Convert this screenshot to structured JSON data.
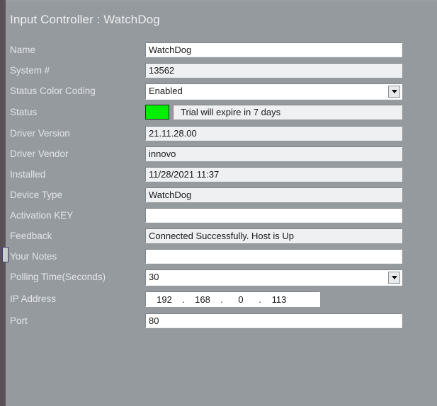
{
  "window": {
    "title": "Input Controller : WatchDog",
    "background_color": "#959a9e",
    "label_color": "#e3e5e8"
  },
  "form": {
    "rows": [
      {
        "label": "Name",
        "value": "WatchDog",
        "control": "text",
        "readonly": false
      },
      {
        "label": "System #",
        "value": "13562",
        "control": "text",
        "readonly": true
      },
      {
        "label": "Status Color Coding",
        "value": "Enabled",
        "control": "combobox",
        "readonly": false
      },
      {
        "label": "Status",
        "value": "Trial will expire in 7 days",
        "control": "status",
        "readonly": true
      },
      {
        "label": "Driver Version",
        "value": "21.11.28.00",
        "control": "text",
        "readonly": true
      },
      {
        "label": "Driver Vendor",
        "value": "innovo",
        "control": "text",
        "readonly": true
      },
      {
        "label": "Installed",
        "value": "11/28/2021 11:37",
        "control": "text",
        "readonly": true
      },
      {
        "label": "Device Type",
        "value": "WatchDog",
        "control": "text",
        "readonly": true
      },
      {
        "label": "Activation KEY",
        "value": "",
        "control": "text",
        "readonly": false
      },
      {
        "label": "Feedback",
        "value": "Connected Successfully.  Host is Up",
        "control": "text",
        "readonly": true
      },
      {
        "label": "Your Notes",
        "value": "",
        "control": "text",
        "readonly": false
      },
      {
        "label": "Polling Time(Seconds)",
        "value": "30",
        "control": "combobox",
        "readonly": false
      },
      {
        "label": "IP Address",
        "value": "192 . 168 . 0 . 113",
        "control": "ip",
        "readonly": false
      },
      {
        "label": "Port",
        "value": "80",
        "control": "text",
        "readonly": false
      }
    ]
  },
  "status_indicator": {
    "color": "#00ee00",
    "message": "Trial will expire in 7 days"
  },
  "ip_address": {
    "octet1": "192",
    "octet2": "168",
    "octet3": "0",
    "octet4": "113",
    "separator": "."
  }
}
